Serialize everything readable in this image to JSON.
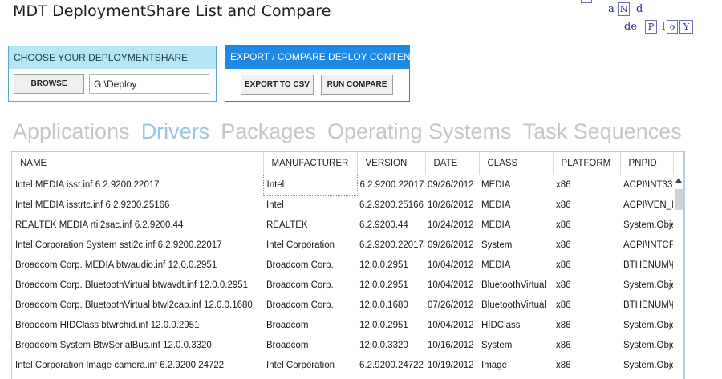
{
  "app": {
    "title": "MDT DeploymentShare List and Compare"
  },
  "logo": {
    "letters_row1": [
      "a",
      "N",
      "d"
    ],
    "letters_row2": [
      "de",
      "P",
      "l",
      "o",
      "Y"
    ]
  },
  "choose_panel": {
    "header": "CHOOSE YOUR DEPLOYMENTSHARE",
    "browse_label": "BROWSE",
    "path_value": "G:\\Deploy"
  },
  "export_panel": {
    "header": "EXPORT / COMPARE DEPLOY CONTENT",
    "export_label": "EXPORT TO CSV",
    "compare_label": "RUN COMPARE"
  },
  "tabs": [
    {
      "label": "Applications",
      "active": false
    },
    {
      "label": "Drivers",
      "active": true
    },
    {
      "label": "Packages",
      "active": false
    },
    {
      "label": "Operating Systems",
      "active": false
    },
    {
      "label": "Task Sequences",
      "active": false
    }
  ],
  "grid": {
    "columns": [
      "NAME",
      "MANUFACTURER",
      "VERSION",
      "DATE",
      "CLASS",
      "PLATFORM",
      "PNPID"
    ],
    "rows": [
      [
        "Intel MEDIA isst.inf 6.2.9200.22017",
        "Intel",
        "6.2.9200.22017",
        "09/26/2012",
        "MEDIA",
        "x86",
        "ACPI\\INT33E"
      ],
      [
        "Intel MEDIA isstrtc.inf 6.2.9200.25166",
        "Intel",
        "6.2.9200.25166",
        "10/26/2012",
        "MEDIA",
        "x86",
        "ACPI\\VEN_IN"
      ],
      [
        "REALTEK MEDIA rtii2sac.inf 6.2.9200.44",
        "REALTEK",
        "6.2.9200.44",
        "10/24/2012",
        "MEDIA",
        "x86",
        "System.Obje"
      ],
      [
        "Intel Corporation System ssti2c.inf 6.2.9200.22017",
        "Intel Corporation",
        "6.2.9200.22017",
        "09/26/2012",
        "System",
        "x86",
        "ACPI\\INTCFI"
      ],
      [
        "Broadcom Corp. MEDIA btwaudio.inf 12.0.0.2951",
        "Broadcom Corp.",
        "12.0.0.2951",
        "10/04/2012",
        "MEDIA",
        "x86",
        "BTHENUM\\{"
      ],
      [
        "Broadcom Corp. BluetoothVirtual btwavdt.inf 12.0.0.2951",
        "Broadcom Corp.",
        "12.0.0.2951",
        "10/04/2012",
        "BluetoothVirtual",
        "x86",
        "System.Obje"
      ],
      [
        "Broadcom Corp. BluetoothVirtual btwl2cap.inf 12.0.0.1680",
        "Broadcom Corp.",
        "12.0.0.1680",
        "07/26/2012",
        "BluetoothVirtual",
        "x86",
        "BTHENUM\\{"
      ],
      [
        "Broadcom HIDClass btwrchid.inf 12.0.0.2951",
        "Broadcom",
        "12.0.0.2951",
        "10/04/2012",
        "HIDClass",
        "x86",
        "System.Obje"
      ],
      [
        "Broadcom System BtwSerialBus.inf 12.0.0.3320",
        "Broadcom",
        "12.0.0.3320",
        "10/16/2012",
        "System",
        "x86",
        "System.Obje"
      ],
      [
        "Intel Corporation Image camera.inf 6.2.9200.24722",
        "Intel Corporation",
        "6.2.9200.24722",
        "10/19/2012",
        "Image",
        "x86",
        "System.Obje"
      ]
    ]
  }
}
